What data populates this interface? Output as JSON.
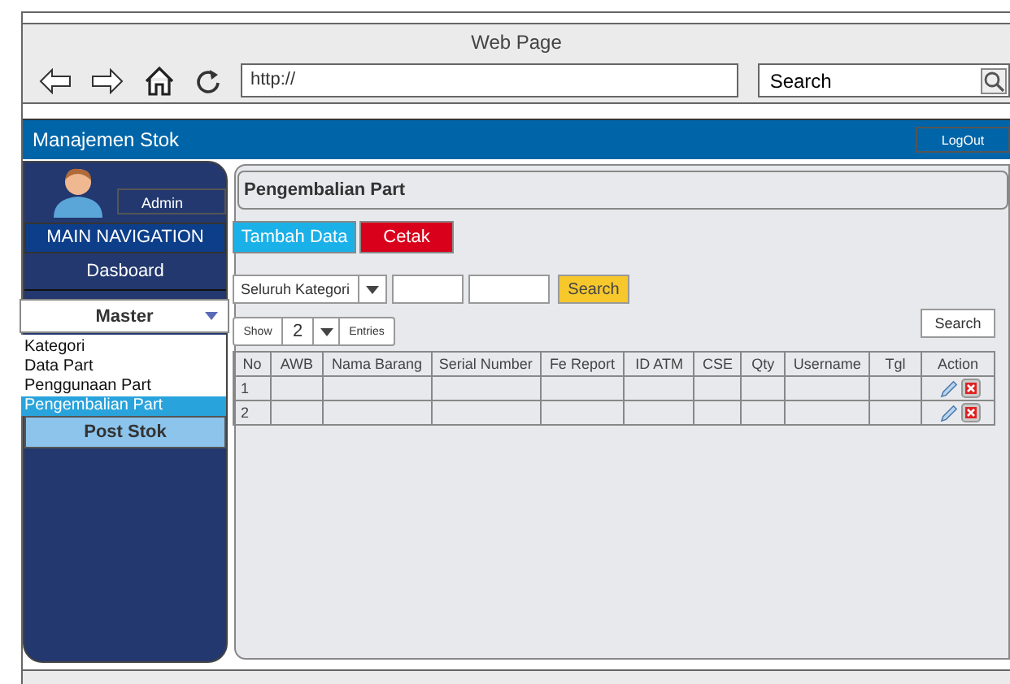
{
  "window": {
    "title": "Web Page",
    "url": "http://",
    "search": "Search"
  },
  "app": {
    "title": "Manajemen Stok",
    "logout": "LogOut"
  },
  "sidebar": {
    "user": "Admin",
    "heading": "MAIN NAVIGATION",
    "dashboard": "Dasboard",
    "master": {
      "label": "Master",
      "expanded": true,
      "items": [
        {
          "label": "Kategori",
          "selected": false
        },
        {
          "label": "Data Part",
          "selected": false
        },
        {
          "label": "Penggunaan Part",
          "selected": false
        },
        {
          "label": "Pengembalian Part",
          "selected": true
        }
      ]
    },
    "post_stok": "Post Stok"
  },
  "content": {
    "title": "Pengembalian Part",
    "add_button": "Tambah Data",
    "print_button": "Cetak",
    "filter": {
      "category": "Seluruh Kategori",
      "search_button": "Search"
    },
    "show": {
      "label": "Show",
      "value": "2",
      "suffix": "Entries"
    },
    "search_button": "Search"
  },
  "table": {
    "columns": [
      "No",
      "AWB",
      "Nama Barang",
      "Serial Number",
      "Fe Report",
      "ID ATM",
      "CSE",
      "Qty",
      "Username",
      "Tgl",
      "Action"
    ],
    "rows": [
      {
        "no": "1"
      },
      {
        "no": "2"
      }
    ]
  }
}
